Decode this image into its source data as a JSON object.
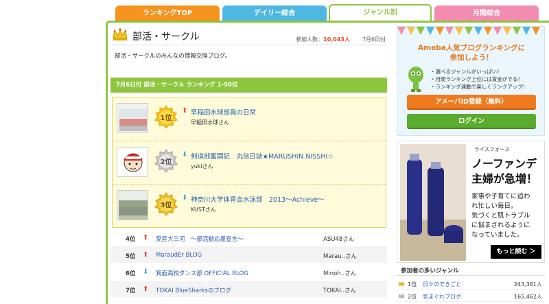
{
  "tabs": [
    {
      "label": "ランキングTOP"
    },
    {
      "label": "デイリー総合"
    },
    {
      "label": "ジャンル別"
    },
    {
      "label": "月間総合"
    }
  ],
  "genre": {
    "title": "部活・サークル",
    "participants_label": "参加人数：",
    "participants_count": "10,043人",
    "date": "7月6日付",
    "description": "部活・サークルのみんなの情報交換ブログ。"
  },
  "ranking_header": "7月6日付 部活・サークル ランキング 1-50位",
  "top3": [
    {
      "rank": "1位",
      "trend": "up",
      "title": "早稲田水球部員の日常",
      "user": "早稲田水球さん"
    },
    {
      "rank": "2位",
      "trend": "down",
      "title": "剣道部奮闘記　丸信日誌★MARUSHIN NISSHI☆",
      "user": "yukiさん"
    },
    {
      "rank": "3位",
      "trend": "down",
      "title": "神奈川大学体育会水泳部　2013～Achieve～",
      "user": "KUSTさん"
    }
  ],
  "rows": [
    {
      "pos": "4位",
      "trend": "up",
      "title": "愛産大三河　～部活動応援宣言～",
      "user": "ASU48さん"
    },
    {
      "pos": "5位",
      "trend": "up",
      "title": "MaraudEr BLOG",
      "user": "Marau..さん"
    },
    {
      "pos": "6位",
      "trend": "down",
      "title": "箕面高校ダンス部 OFFICIAL BLOG",
      "user": "Minoh..さん"
    },
    {
      "pos": "7位",
      "trend": "up",
      "title": "TOKAI BlueSharksのブログ",
      "user": "TOKAI..さん"
    }
  ],
  "promo": {
    "title_line1": "Ameba人気ブログランキングに",
    "title_line2": "参加しよう！",
    "bullets": [
      "・選べるジャンルがいっぱい！",
      "・月間ランキング上位には賞金がでる！",
      "・ランキング連動で楽しくランクアップ！"
    ],
    "register_button": "アメーバID登録（無料）",
    "login_button": "ログイン"
  },
  "ad": {
    "brand": "ライスフォース",
    "headline_line1": "ノーファンデ",
    "headline_line2": "主婦が急増！",
    "body_lines": [
      "家事や子育てに追わ",
      "れ忙しい毎日。",
      "気づくと肌トラブル",
      "に悩まされるように",
      "なっていました。"
    ],
    "button": "もっと読む ＞"
  },
  "popular_genres": {
    "header": "参加者の多いジャンル",
    "items": [
      {
        "rank": "1位",
        "name": "日々のできごと",
        "count": "243,361人"
      },
      {
        "rank": "2位",
        "name": "気まぐれブログ",
        "count": "165,462人"
      }
    ]
  },
  "colors": {
    "accent_green": "#8cc63f",
    "tab_orange": "#f6931e",
    "tab_blue": "#4fb8e2",
    "tab_pink": "#f48bb0",
    "up_arrow": "#e4463b",
    "down_arrow": "#4aa3d9"
  }
}
